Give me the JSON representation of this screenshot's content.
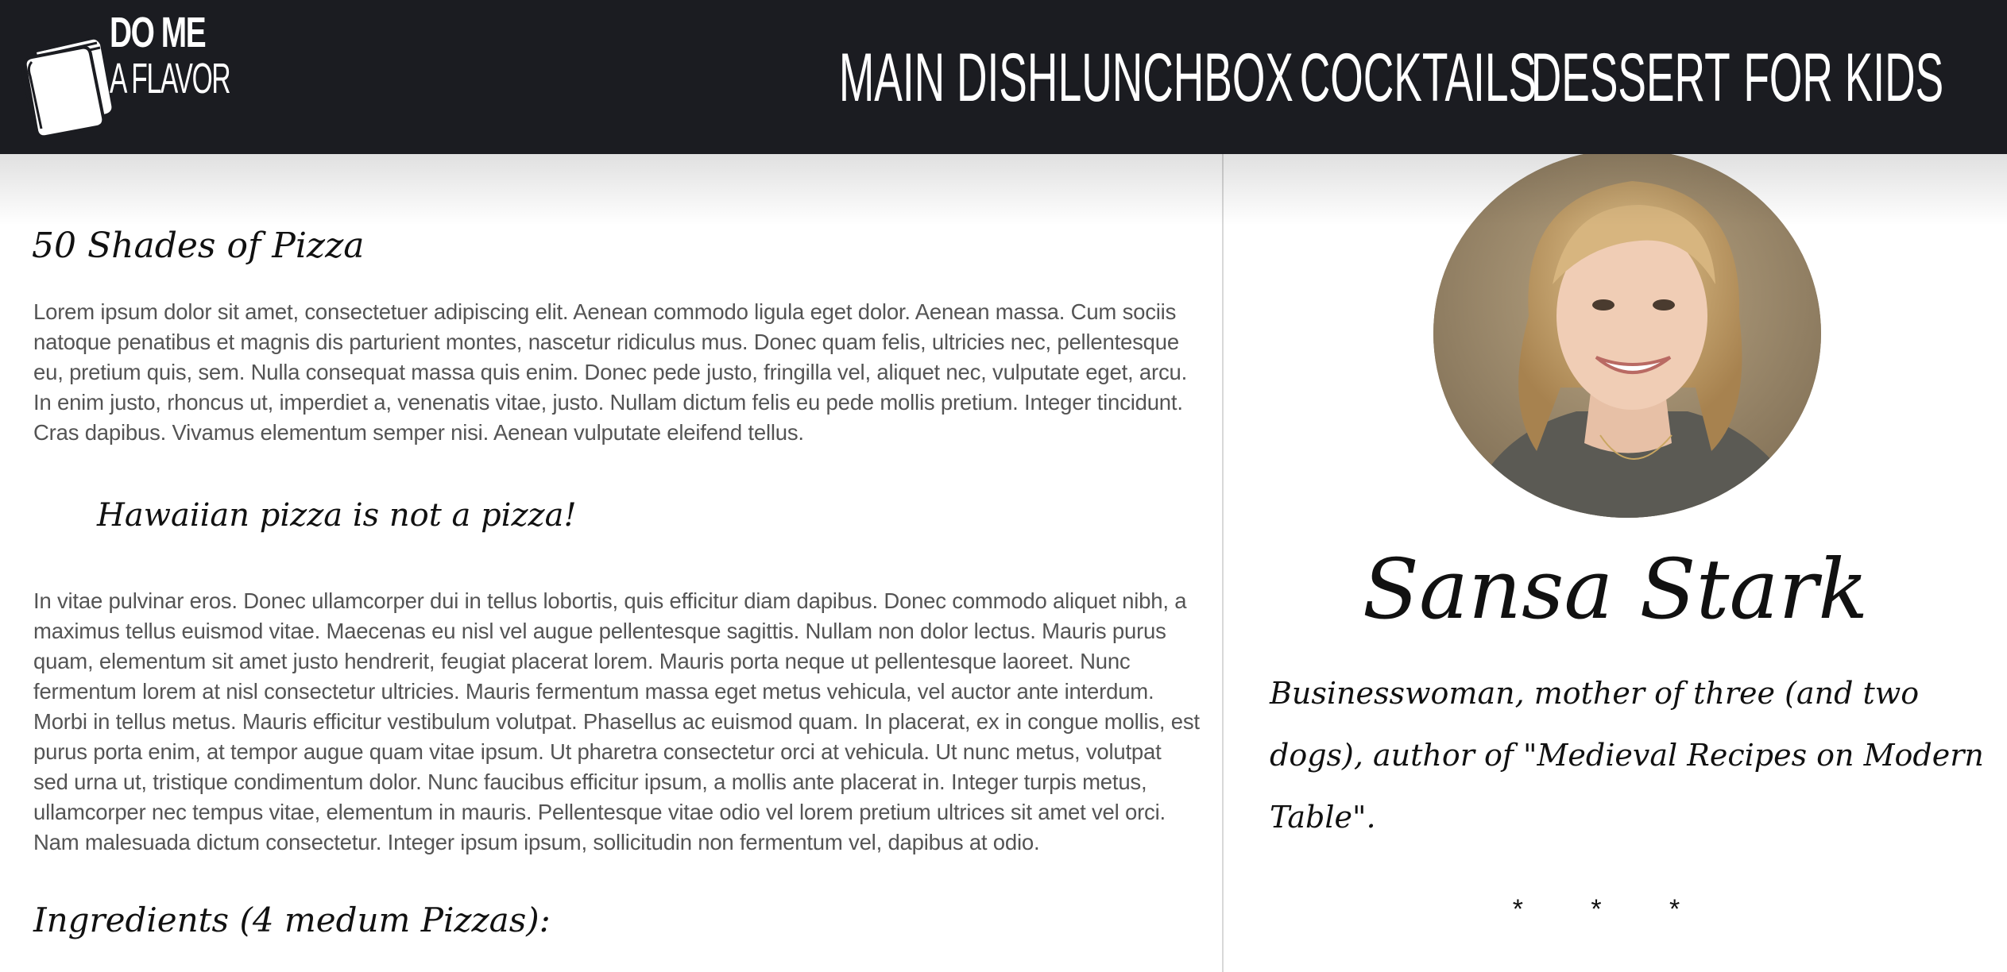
{
  "header": {
    "logo": {
      "line1": "DO ME",
      "line2": "A FLAVOR"
    },
    "nav": [
      {
        "label": "MAIN DISH"
      },
      {
        "label": "LUNCHBOX"
      },
      {
        "label": "COCKTAILS"
      },
      {
        "label": "DESSERT"
      },
      {
        "label": "FOR KIDS"
      }
    ]
  },
  "article": {
    "title": "50 Shades of Pizza",
    "paragraph1": "Lorem ipsum dolor sit amet, consectetuer adipiscing elit. Aenean commodo ligula eget dolor. Aenean massa. Cum sociis natoque penatibus et magnis dis parturient montes, nascetur ridiculus mus. Donec quam felis, ultricies nec, pellentesque eu, pretium quis, sem. Nulla consequat massa quis enim. Donec pede justo, fringilla vel, aliquet nec, vulputate eget, arcu. In enim justo, rhoncus ut, imperdiet a, venenatis vitae, justo. Nullam dictum felis eu pede mollis pretium. Integer tincidunt. Cras dapibus. Vivamus elementum semper nisi. Aenean vulputate eleifend tellus.",
    "quote": "Hawaiian pizza is not a pizza!",
    "paragraph2": "In vitae pulvinar eros. Donec ullamcorper dui in tellus lobortis, quis efficitur diam dapibus. Donec commodo aliquet nibh, a maximus tellus euismod vitae. Maecenas eu nisl vel augue pellentesque sagittis. Nullam non dolor lectus. Mauris purus quam, elementum sit amet justo hendrerit, feugiat placerat lorem. Mauris porta neque ut pellentesque laoreet. Nunc fermentum lorem at nisl consectetur ultricies. Mauris fermentum massa eget metus vehicula, vel auctor ante interdum. Morbi in tellus metus. Mauris efficitur vestibulum volutpat. Phasellus ac euismod quam. In placerat, ex in congue mollis, est purus porta enim, at tempor augue quam vitae ipsum. Ut pharetra consectetur orci at vehicula. Ut nunc metus, volutpat sed urna ut, tristique condimentum dolor. Nunc faucibus efficitur ipsum, a mollis ante placerat in. Integer turpis metus, ullamcorper nec tempus vitae, elementum in mauris. Pellentesque vitae odio vel lorem pretium ultrices sit amet vel orci. Nam malesuada dictum consectetur. Integer ipsum ipsum, sollicitudin non fermentum vel, dapibus at odio.",
    "ingredients_heading": "Ingredients (4 medum Pizzas):"
  },
  "author": {
    "name": "Sansa Stark",
    "bio": "Businesswoman, mother of three (and two dogs), author of \"Medieval Recipes on Modern Table\".",
    "separator": "* * *"
  },
  "colors": {
    "header_bg": "#1b1c21",
    "body_text": "#545454",
    "script_text": "#111111"
  }
}
